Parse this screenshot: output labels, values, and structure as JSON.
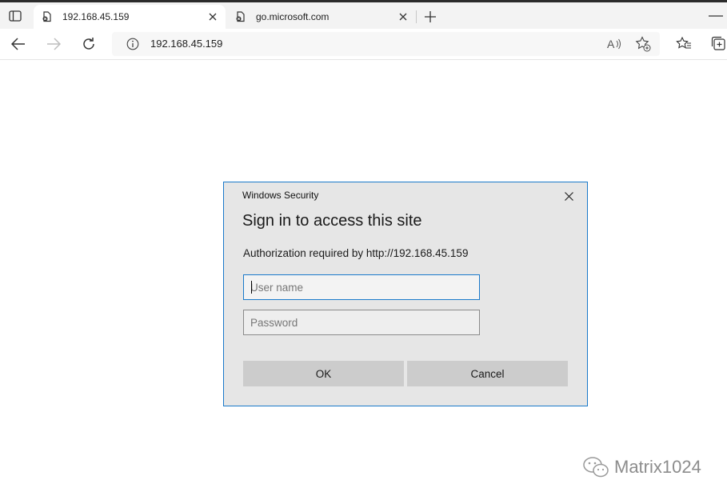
{
  "browser": {
    "tabs": [
      {
        "title": "192.168.45.159",
        "active": true
      },
      {
        "title": "go.microsoft.com",
        "active": false
      }
    ],
    "address": "192.168.45.159"
  },
  "dialog": {
    "caption": "Windows Security",
    "heading": "Sign in to access this site",
    "message": "Authorization required by http://192.168.45.159",
    "username": {
      "value": "",
      "placeholder": "User name"
    },
    "password": {
      "value": "",
      "placeholder": "Password"
    },
    "ok_label": "OK",
    "cancel_label": "Cancel"
  },
  "watermark": {
    "text": "Matrix1024"
  },
  "icons": {
    "tab_actions": "tab-actions-icon",
    "favicon": "page-broken-icon",
    "close": "close-icon",
    "new_tab": "plus-icon",
    "back": "back-arrow-icon",
    "forward": "forward-arrow-icon",
    "refresh": "refresh-icon",
    "info": "info-icon",
    "read_aloud": "read-aloud-icon",
    "favorite_add": "star-add-icon",
    "favorites": "favorites-icon",
    "collections": "collections-icon",
    "wechat": "wechat-logo-icon"
  },
  "colors": {
    "accent": "#1979ca",
    "dialog_bg": "#e6e6e6",
    "button_bg": "#cccccc"
  }
}
